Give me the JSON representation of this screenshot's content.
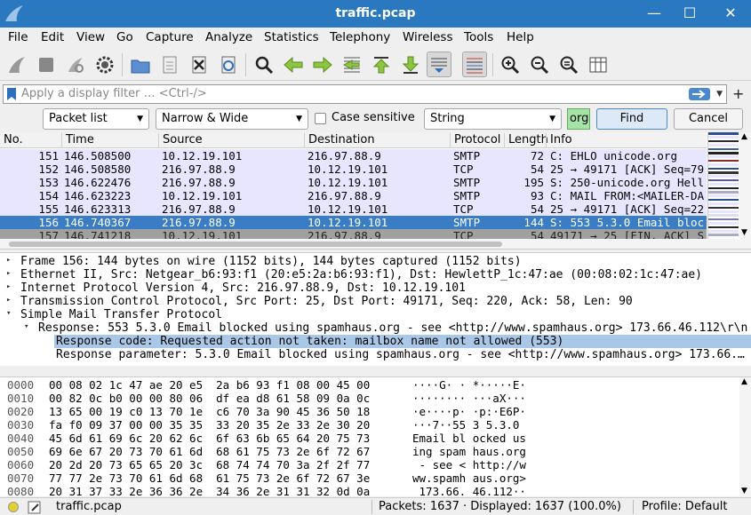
{
  "window": {
    "title": "traffic.pcap"
  },
  "menu": [
    "File",
    "Edit",
    "View",
    "Go",
    "Capture",
    "Analyze",
    "Statistics",
    "Telephony",
    "Wireless",
    "Tools",
    "Help"
  ],
  "toolbar_icons": [
    "shark-fin-start-icon",
    "stop-capture-icon",
    "restart-capture-icon",
    "capture-options-icon",
    "open-file-icon",
    "save-file-icon",
    "close-file-icon",
    "reload-file-icon",
    "find-packet-icon",
    "go-back-icon",
    "go-forward-icon",
    "go-to-packet-icon",
    "go-first-icon",
    "go-last-icon",
    "auto-scroll-icon",
    "colorize-icon",
    "zoom-in-icon",
    "zoom-out-icon",
    "zoom-normal-icon",
    "resize-columns-icon"
  ],
  "filter": {
    "placeholder": "Apply a display filter … <Ctrl-/>"
  },
  "find": {
    "search_in": "Packet list",
    "char_width": "Narrow & Wide",
    "case_label": "Case sensitive",
    "search_type": "String",
    "find_value": "org",
    "find_label": "Find",
    "cancel_label": "Cancel"
  },
  "columns": [
    "No.",
    "Time",
    "Source",
    "Destination",
    "Protocol",
    "Length",
    "Info"
  ],
  "packets": [
    {
      "no": "151",
      "time": "146.508500",
      "src": "10.12.19.101",
      "dst": "216.97.88.9",
      "proto": "SMTP",
      "len": "72",
      "info": "C: EHLO unicode.org"
    },
    {
      "no": "152",
      "time": "146.508580",
      "src": "216.97.88.9",
      "dst": "10.12.19.101",
      "proto": "TCP",
      "len": "54",
      "info": "25 → 49171 [ACK] Seq=79"
    },
    {
      "no": "153",
      "time": "146.622476",
      "src": "216.97.88.9",
      "dst": "10.12.19.101",
      "proto": "SMTP",
      "len": "195",
      "info": "S: 250-unicode.org Hell"
    },
    {
      "no": "154",
      "time": "146.623223",
      "src": "10.12.19.101",
      "dst": "216.97.88.9",
      "proto": "SMTP",
      "len": "93",
      "info": "C: MAIL FROM:<MAILER-DA"
    },
    {
      "no": "155",
      "time": "146.623313",
      "src": "216.97.88.9",
      "dst": "10.12.19.101",
      "proto": "TCP",
      "len": "54",
      "info": "25 → 49171 [ACK] Seq=22"
    },
    {
      "no": "156",
      "time": "146.740367",
      "src": "216.97.88.9",
      "dst": "10.12.19.101",
      "proto": "SMTP",
      "len": "144",
      "info": "S: 553 5.3.0 Email bloc"
    },
    {
      "no": "157",
      "time": "146.741218",
      "src": "10.12.19.101",
      "dst": "216.97.88.9",
      "proto": "TCP",
      "len": "54",
      "info": "49171 → 25 [FIN, ACK] S"
    }
  ],
  "details": [
    {
      "exp": "▸",
      "text": "Frame 156: 144 bytes on wire (1152 bits), 144 bytes captured (1152 bits)"
    },
    {
      "exp": "▸",
      "text": "Ethernet II, Src: Netgear_b6:93:f1 (20:e5:2a:b6:93:f1), Dst: HewlettP_1c:47:ae (00:08:02:1c:47:ae)"
    },
    {
      "exp": "▸",
      "text": "Internet Protocol Version 4, Src: 216.97.88.9, Dst: 10.12.19.101"
    },
    {
      "exp": "▸",
      "text": "Transmission Control Protocol, Src Port: 25, Dst Port: 49171, Seq: 220, Ack: 58, Len: 90"
    },
    {
      "exp": "▾",
      "text": "Simple Mail Transfer Protocol"
    },
    {
      "exp": "▾",
      "text": "Response: 553 5.3.0 Email blocked using spamhaus.org - see <http://www.spamhaus.org> 173.66.46.112\\r\\n"
    },
    {
      "exp": "",
      "text": "Response code: Requested action not taken: mailbox name not allowed (553)"
    },
    {
      "exp": "",
      "text": "Response parameter: 5.3.0 Email blocked using spamhaus.org - see <http://www.spamhaus.org> 173.66.…"
    }
  ],
  "bytes": [
    {
      "off": "0000",
      "hex": "00 08 02 1c 47 ae 20 e5  2a b6 93 f1 08 00 45 00",
      "ascii": "····G· · *·····E·"
    },
    {
      "off": "0010",
      "hex": "00 82 0c b0 00 00 80 06  df ea d8 61 58 09 0a 0c",
      "ascii": "········ ···aX···"
    },
    {
      "off": "0020",
      "hex": "13 65 00 19 c0 13 70 1e  c6 70 3a 90 45 36 50 18",
      "ascii": "·e····p· ·p:·E6P·"
    },
    {
      "off": "0030",
      "hex": "fa f0 09 37 00 00 35 35  33 20 35 2e 33 2e 30 20",
      "ascii": "···7··55 3 5.3.0 "
    },
    {
      "off": "0040",
      "hex": "45 6d 61 69 6c 20 62 6c  6f 63 6b 65 64 20 75 73",
      "ascii": "Email bl ocked us"
    },
    {
      "off": "0050",
      "hex": "69 6e 67 20 73 70 61 6d  68 61 75 73 2e 6f 72 67",
      "ascii": "ing spam haus.org"
    },
    {
      "off": "0060",
      "hex": "20 2d 20 73 65 65 20 3c  68 74 74 70 3a 2f 2f 77",
      "ascii": " - see < http://w"
    },
    {
      "off": "0070",
      "hex": "77 77 2e 73 70 61 6d 68  61 75 73 2e 6f 72 67 3e",
      "ascii": "ww.spamh aus.org>"
    },
    {
      "off": "0080",
      "hex": "20 31 37 33 2e 36 36 2e  34 36 2e 31 31 32 0d 0a",
      "ascii": " 173.66. 46.112··"
    }
  ],
  "status": {
    "file": "traffic.pcap",
    "packets": "Packets: 1637 · Displayed: 1637 (100.0%)",
    "profile": "Profile: Default"
  },
  "colors": {
    "titlebar": "#2a78c0",
    "smtp_row": "#e8e5ff",
    "selected_row": "#3b7dc4",
    "find_ok": "#a6e3a6",
    "tcp_row": "#e8e5ff"
  }
}
